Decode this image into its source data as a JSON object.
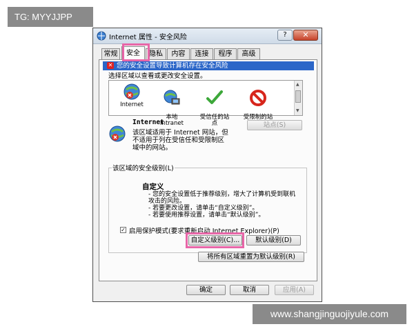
{
  "tag": "TG: MYYJJPP",
  "site": "www.shangjinguojiyule.com",
  "window": {
    "title": "Internet 属性 - 安全风险",
    "help_label": "?",
    "close_label": "✕"
  },
  "tabs": [
    "常规",
    "安全",
    "隐私",
    "内容",
    "连接",
    "程序",
    "高级"
  ],
  "active_tab": "安全",
  "banner": "您的安全设置导致计算机存在安全风险",
  "instruction": "选择区域以查看或更改安全设置。",
  "zones": [
    {
      "label": "Internet",
      "icon": "globe-icon"
    },
    {
      "label": "本地\nIntranet",
      "icon": "intranet-icon"
    },
    {
      "label": "受信任的站\n点",
      "icon": "check-icon"
    },
    {
      "label": "受限制的站\n点",
      "icon": "restricted-icon"
    }
  ],
  "zone_info": {
    "title": "Internet",
    "desc": "该区域适用于 Internet 网站，但不适用于列在受信任和受限制区域中的网站。",
    "sites_button": "站点(S)"
  },
  "security_level": {
    "group_label": "该区域的安全级别(L)",
    "title": "自定义",
    "lines": [
      "- 您的安全设置低于推荐级别，增大了计算机受到联机攻击的风险。",
      "- 若要更改设置，请单击“自定义级别”。",
      "- 若要使用推荐设置，请单击“默认级别”。"
    ]
  },
  "protected_mode": {
    "label": "启用保护模式(要求重新启动 Internet Explorer)(P)",
    "checked": true
  },
  "buttons": {
    "custom_level": "自定义级别(C)...",
    "default_level": "默认级别(D)",
    "reset_all": "将所有区域重置为默认级别(R)",
    "ok": "确定",
    "cancel": "取消",
    "apply": "应用(A)"
  },
  "colors": {
    "banner": "#2b66c8",
    "highlight": "#e866a8"
  }
}
